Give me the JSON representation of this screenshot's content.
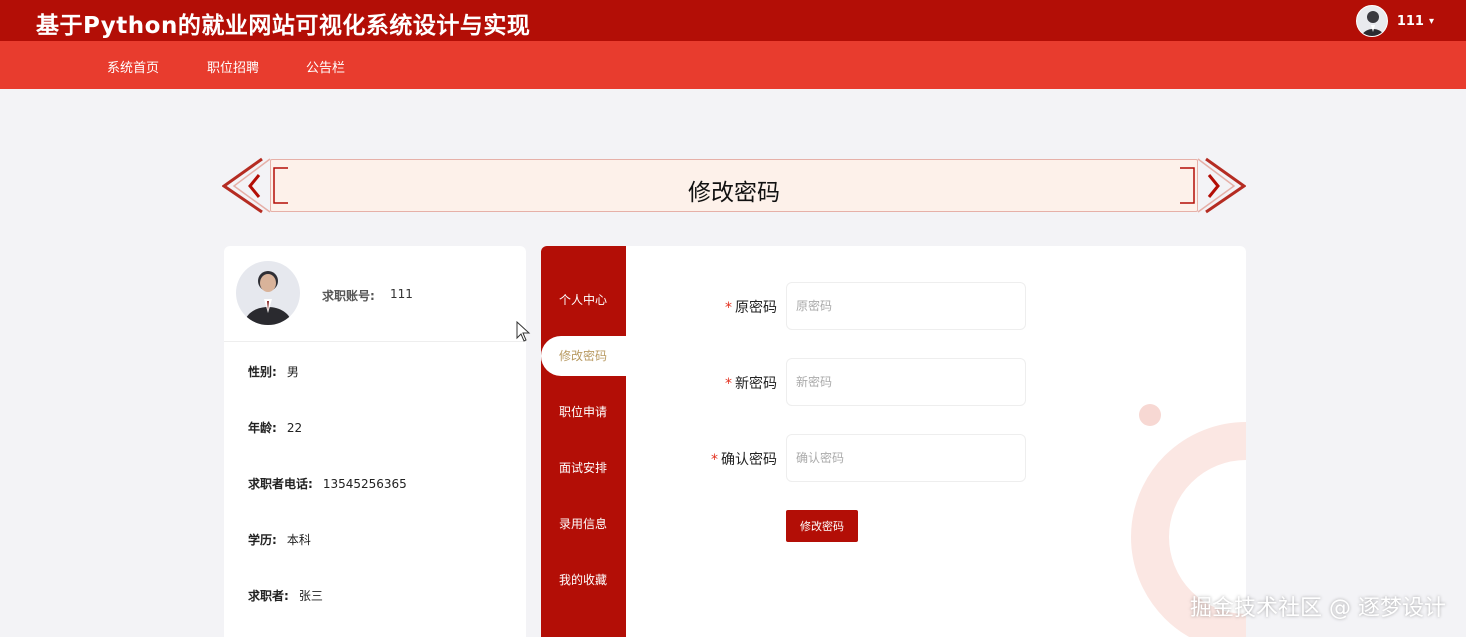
{
  "header": {
    "site_title": "基于Python的就业网站可视化系统设计与实现",
    "user_name": "111",
    "caret": "▾"
  },
  "nav": {
    "items": [
      "系统首页",
      "职位招聘",
      "公告栏"
    ]
  },
  "banner": {
    "title": "修改密码"
  },
  "profile": {
    "account_label": "求职账号:",
    "account_value": "111",
    "fields": [
      {
        "label": "性别:",
        "value": "男"
      },
      {
        "label": "年龄:",
        "value": "22"
      },
      {
        "label": "求职者电话:",
        "value": "13545256365"
      },
      {
        "label": "学历:",
        "value": "本科"
      },
      {
        "label": "求职者:",
        "value": "张三"
      }
    ]
  },
  "side_tabs": [
    "个人中心",
    "修改密码",
    "职位申请",
    "面试安排",
    "录用信息",
    "我的收藏"
  ],
  "active_tab": "修改密码",
  "form": {
    "required_mark": "*",
    "old_password": {
      "label": "原密码",
      "placeholder": "原密码",
      "value": ""
    },
    "new_password": {
      "label": "新密码",
      "placeholder": "新密码",
      "value": ""
    },
    "confirm_password": {
      "label": "确认密码",
      "placeholder": "确认密码",
      "value": ""
    },
    "submit_label": "修改密码"
  },
  "watermark": "掘金技术社区 @ 逐梦设计",
  "colors": {
    "primary_dark_red": "#b30e06",
    "nav_red": "#e83c2e",
    "page_bg": "#f3f3f6",
    "active_tab_text": "#b89a62"
  }
}
